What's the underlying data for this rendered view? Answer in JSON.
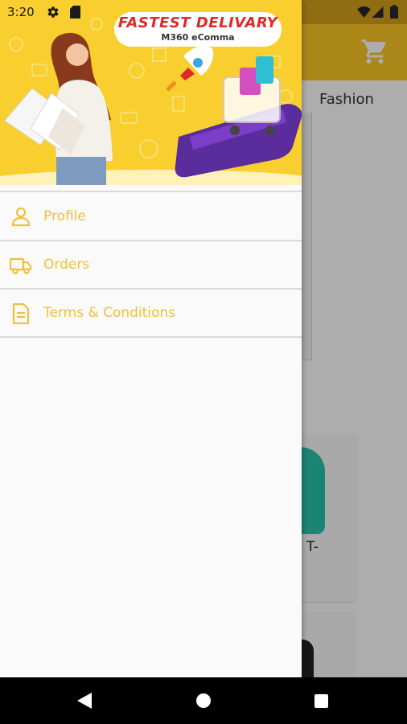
{
  "status_bar": {
    "time": "3:20",
    "icons": [
      "settings-icon",
      "sd-card-icon",
      "wifi-icon",
      "signal-icon",
      "battery-icon"
    ]
  },
  "background_screen": {
    "category_tab": "Fashion",
    "product_name_fragment": "T-",
    "icons": [
      "cart-icon"
    ]
  },
  "drawer": {
    "banner": {
      "title": "FASTEST DELIVARY",
      "subtitle": "M360 eComma"
    },
    "menu_items": [
      {
        "label": "Profile",
        "icon": "person-icon"
      },
      {
        "label": "Orders",
        "icon": "truck-icon"
      },
      {
        "label": "Terms & Conditions",
        "icon": "document-icon"
      }
    ]
  },
  "nav_bar": {
    "icons": [
      "back-icon",
      "home-icon",
      "recents-icon"
    ]
  },
  "colors": {
    "accent": "#fdc827",
    "menu_text": "#f0c03a",
    "banner_title": "#e0292b",
    "drawer_bg": "#fafafa",
    "nav_bar": "#000000"
  }
}
